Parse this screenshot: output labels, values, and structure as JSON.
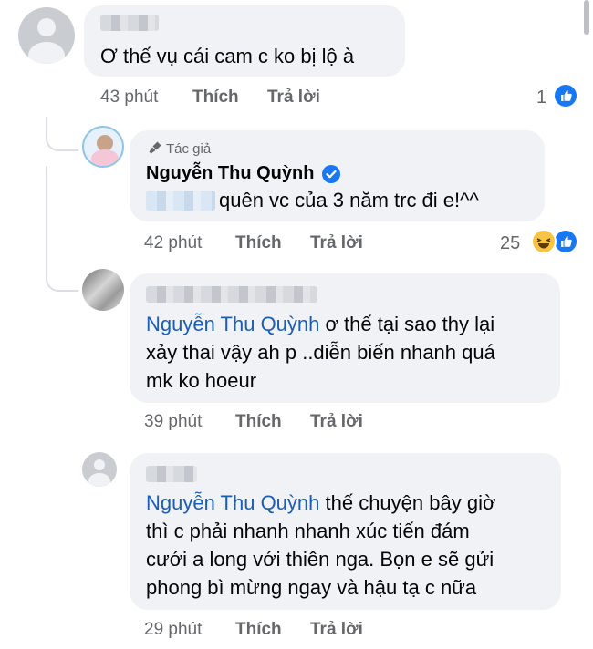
{
  "comments": [
    {
      "text": "Ơ thế vụ cái cam c ko bị lộ à",
      "time": "43 phút",
      "like_action": "Thích",
      "reply_action": "Trả lời",
      "reaction_count": "1"
    },
    {
      "author_label": "Tác giả",
      "author_name": "Nguyễn Thu Quỳnh",
      "text": "quên vc của 3 năm trc đi e!^^",
      "time": "42 phút",
      "like_action": "Thích",
      "reply_action": "Trả lời",
      "reaction_count": "25"
    },
    {
      "mention": "Nguyễn Thu Quỳnh",
      "text_line1": " ơ thế tại sao thy lại",
      "text_line2": "xảy thai vậy ah p ..diễn biến nhanh quá",
      "text_line3": "mk ko hoeur",
      "time": "39 phút",
      "like_action": "Thích",
      "reply_action": "Trả lời"
    },
    {
      "mention": "Nguyễn Thu Quỳnh",
      "text_line1": " thế chuyện bây giờ",
      "text_line2": "thì c phải nhanh nhanh xúc tiến đám",
      "text_line3": "cưới a long với thiên nga. Bọn e sẽ gửi",
      "text_line4": "phong bì mừng ngay và hậu tạ c nữa",
      "time": "29 phút",
      "like_action": "Thích",
      "reply_action": "Trả lời"
    }
  ],
  "icons": {
    "like": "like-icon",
    "haha": "haha-icon",
    "author_badge": "microphone-icon",
    "verified": "verified-badge-icon"
  },
  "colors": {
    "bubble": "#f0f2f5",
    "mention": "#1a5fb4",
    "meta": "#65676b",
    "like_blue": "#1877f2"
  }
}
